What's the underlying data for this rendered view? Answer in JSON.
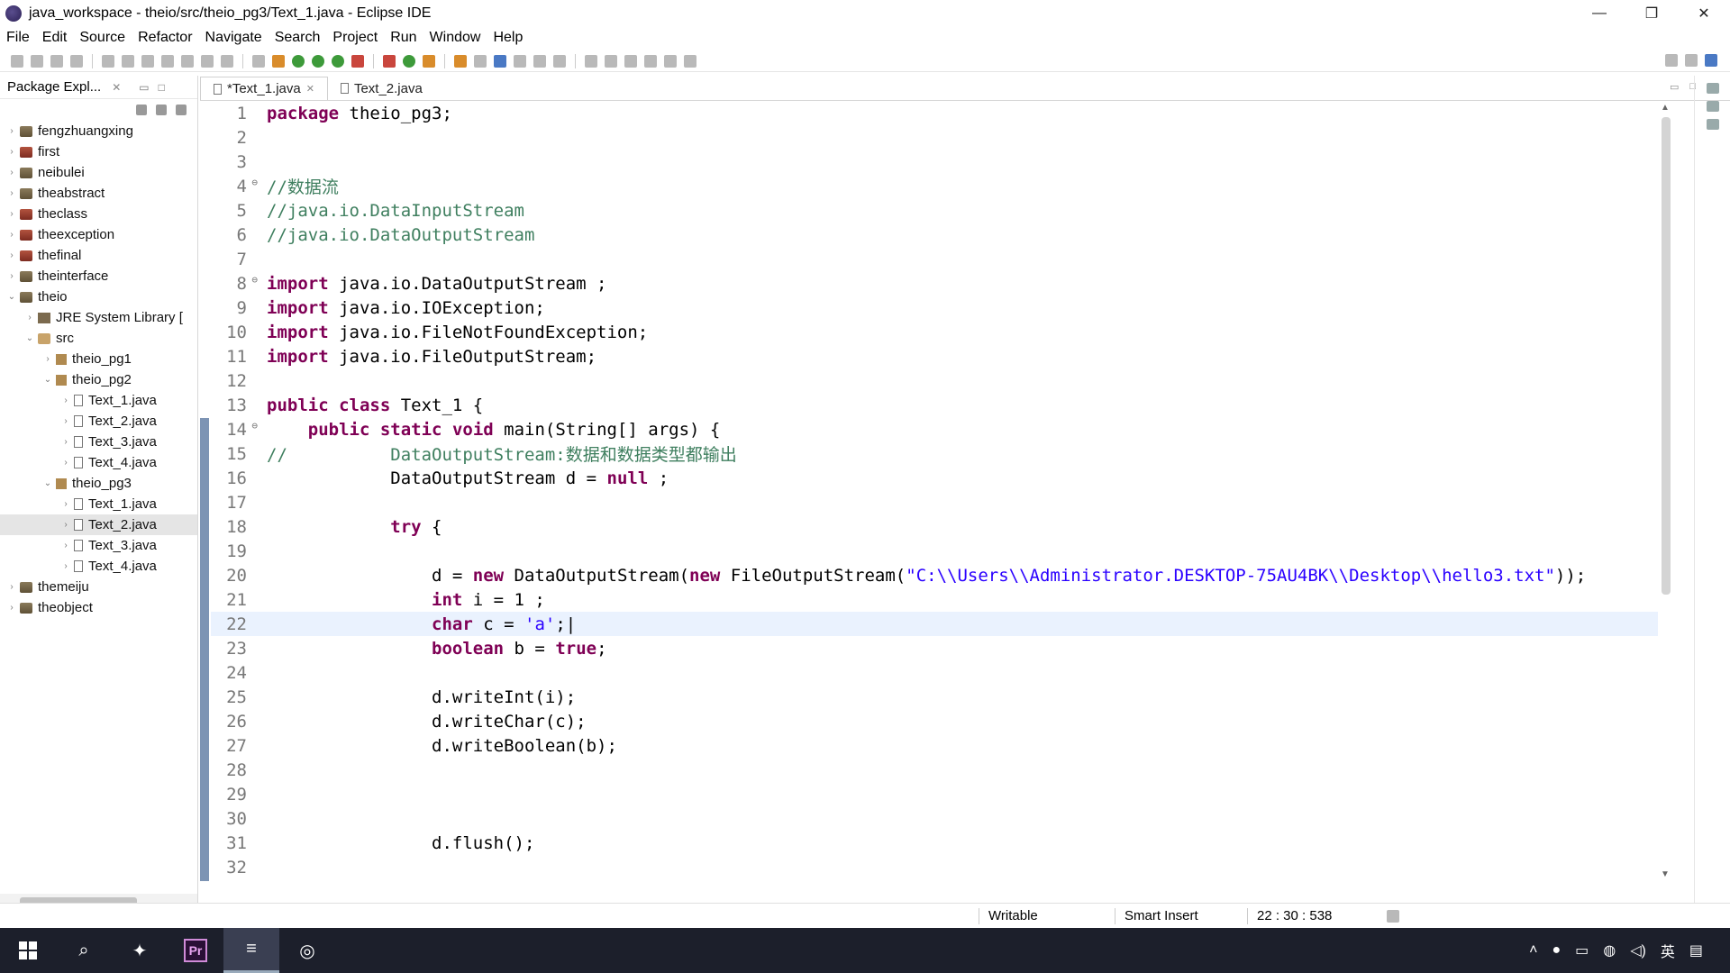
{
  "window": {
    "title": "java_workspace - theio/src/theio_pg3/Text_1.java - Eclipse IDE",
    "controls": [
      "—",
      "❐",
      "✕"
    ]
  },
  "menu": [
    "File",
    "Edit",
    "Source",
    "Refactor",
    "Navigate",
    "Search",
    "Project",
    "Run",
    "Window",
    "Help"
  ],
  "package_explorer": {
    "title": "Package Expl...",
    "tree": [
      {
        "label": "fengzhuangxing",
        "depth": 0,
        "arrow": "›",
        "icon": "proj"
      },
      {
        "label": "first",
        "depth": 0,
        "arrow": "›",
        "icon": "projerr"
      },
      {
        "label": "neibulei",
        "depth": 0,
        "arrow": "›",
        "icon": "proj"
      },
      {
        "label": "theabstract",
        "depth": 0,
        "arrow": "›",
        "icon": "proj"
      },
      {
        "label": "theclass",
        "depth": 0,
        "arrow": "›",
        "icon": "projerr"
      },
      {
        "label": "theexception",
        "depth": 0,
        "arrow": "›",
        "icon": "projerr"
      },
      {
        "label": "thefinal",
        "depth": 0,
        "arrow": "›",
        "icon": "projerr"
      },
      {
        "label": "theinterface",
        "depth": 0,
        "arrow": "›",
        "icon": "proj"
      },
      {
        "label": "theio",
        "depth": 0,
        "arrow": "⌄",
        "icon": "proj"
      },
      {
        "label": "JRE System Library [",
        "depth": 1,
        "arrow": "›",
        "icon": "lib"
      },
      {
        "label": "src",
        "depth": 1,
        "arrow": "⌄",
        "icon": "folder"
      },
      {
        "label": "theio_pg1",
        "depth": 2,
        "arrow": "›",
        "icon": "pkgi"
      },
      {
        "label": "theio_pg2",
        "depth": 2,
        "arrow": "⌄",
        "icon": "pkgi"
      },
      {
        "label": "Text_1.java",
        "depth": 3,
        "arrow": "›",
        "icon": "jfile"
      },
      {
        "label": "Text_2.java",
        "depth": 3,
        "arrow": "›",
        "icon": "jfile"
      },
      {
        "label": "Text_3.java",
        "depth": 3,
        "arrow": "›",
        "icon": "jfile"
      },
      {
        "label": "Text_4.java",
        "depth": 3,
        "arrow": "›",
        "icon": "jfile"
      },
      {
        "label": "theio_pg3",
        "depth": 2,
        "arrow": "⌄",
        "icon": "pkgi"
      },
      {
        "label": "Text_1.java",
        "depth": 3,
        "arrow": "›",
        "icon": "jfile"
      },
      {
        "label": "Text_2.java",
        "depth": 3,
        "arrow": "›",
        "icon": "jfile",
        "selected": true
      },
      {
        "label": "Text_3.java",
        "depth": 3,
        "arrow": "›",
        "icon": "jfile"
      },
      {
        "label": "Text_4.java",
        "depth": 3,
        "arrow": "›",
        "icon": "jfile"
      },
      {
        "label": "themeiju",
        "depth": 0,
        "arrow": "›",
        "icon": "proj"
      },
      {
        "label": "theobject",
        "depth": 0,
        "arrow": "›",
        "icon": "proj"
      }
    ]
  },
  "editor": {
    "tabs": [
      {
        "label": "*Text_1.java",
        "active": true
      },
      {
        "label": "Text_2.java",
        "active": false
      }
    ],
    "current_line": 22,
    "lines": [
      {
        "n": "1",
        "html": "<span class='kw'>package</span> theio_pg3;"
      },
      {
        "n": "2",
        "html": ""
      },
      {
        "n": "3",
        "html": ""
      },
      {
        "n": "4",
        "html": "<span class='cm'>//数据流</span>",
        "fold": true
      },
      {
        "n": "5",
        "html": "<span class='cm'>//java.io.DataInputStream</span>"
      },
      {
        "n": "6",
        "html": "<span class='cm'>//java.io.DataOutputStream</span>"
      },
      {
        "n": "7",
        "html": ""
      },
      {
        "n": "8",
        "html": "<span class='kw'>import</span> java.io.DataOutputStream ;",
        "fold": true
      },
      {
        "n": "9",
        "html": "<span class='kw'>import</span> java.io.IOException;"
      },
      {
        "n": "10",
        "html": "<span class='kw'>import</span> java.io.FileNotFoundException;"
      },
      {
        "n": "11",
        "html": "<span class='kw'>import</span> java.io.FileOutputStream;"
      },
      {
        "n": "12",
        "html": ""
      },
      {
        "n": "13",
        "html": "<span class='kw'>public</span> <span class='kw'>class</span> Text_1 {"
      },
      {
        "n": "14",
        "html": "    <span class='kw'>public</span> <span class='kw'>static</span> <span class='kw'>void</span> main(String[] args) {",
        "fold": true
      },
      {
        "n": "15",
        "html": "<span class='cm'>//          DataOutputStream:数据和数据类型都输出</span>"
      },
      {
        "n": "16",
        "html": "            DataOutputStream d = <span class='kw'>null</span> ;"
      },
      {
        "n": "17",
        "html": ""
      },
      {
        "n": "18",
        "html": "            <span class='kw'>try</span> {"
      },
      {
        "n": "19",
        "html": ""
      },
      {
        "n": "20",
        "html": "                d = <span class='kw'>new</span> DataOutputStream(<span class='kw'>new</span> FileOutputStream(<span class='str'>\"C:\\\\Users\\\\Administrator.DESKTOP-75AU4BK\\\\Desktop\\\\hello3.txt\"</span>));"
      },
      {
        "n": "21",
        "html": "                <span class='kw'>int</span> i = 1 ;"
      },
      {
        "n": "22",
        "html": "                <span class='kw'>char</span> c = <span class='str'>'a'</span>;|"
      },
      {
        "n": "23",
        "html": "                <span class='kw'>boolean</span> b = <span class='kw'>true</span>;"
      },
      {
        "n": "24",
        "html": ""
      },
      {
        "n": "25",
        "html": "                d.writeInt(i);"
      },
      {
        "n": "26",
        "html": "                d.writeChar(c);"
      },
      {
        "n": "27",
        "html": "                d.writeBoolean(b);"
      },
      {
        "n": "28",
        "html": ""
      },
      {
        "n": "29",
        "html": ""
      },
      {
        "n": "30",
        "html": ""
      },
      {
        "n": "31",
        "html": "                d.flush();"
      },
      {
        "n": "32",
        "html": ""
      }
    ]
  },
  "status": {
    "writable": "Writable",
    "insert_mode": "Smart Insert",
    "position": "22 : 30 : 538"
  },
  "taskbar": {
    "premiere_label": "Pr",
    "tray_lang": "英"
  }
}
